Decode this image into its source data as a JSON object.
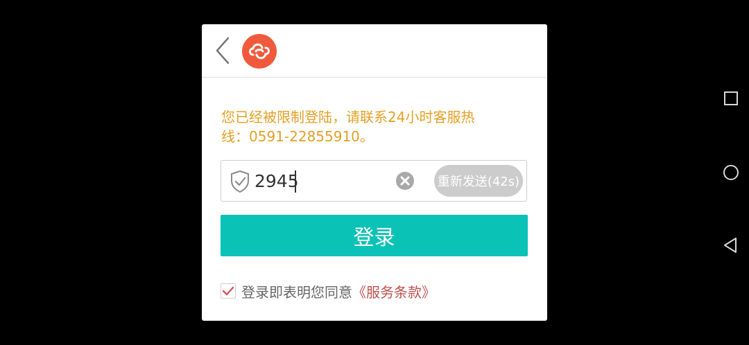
{
  "colors": {
    "accent_teal": "#0bc2b6",
    "warning_orange": "#e4a024",
    "brand_red": "#f05a3c",
    "terms_red": "#c0504d",
    "resend_gray": "#cccccc"
  },
  "header": {
    "back_icon": "chevron-left-icon",
    "logo_icon": "cloud-logo-icon"
  },
  "notice": {
    "text": "您已经被限制登陆，请联系24小时客服热\n线：0591-22855910。"
  },
  "code_field": {
    "icon": "shield-check-icon",
    "value": "2945",
    "clear_icon": "clear-circle-icon",
    "resend_label": "重新发送(42s)"
  },
  "login_button": {
    "label": "登录"
  },
  "agreement": {
    "checked": true,
    "text": "登录即表明您同意",
    "terms_label": "《服务条款》"
  },
  "nav_bar": {
    "icons": [
      "recents-square-icon",
      "home-circle-icon",
      "back-triangle-icon"
    ]
  }
}
